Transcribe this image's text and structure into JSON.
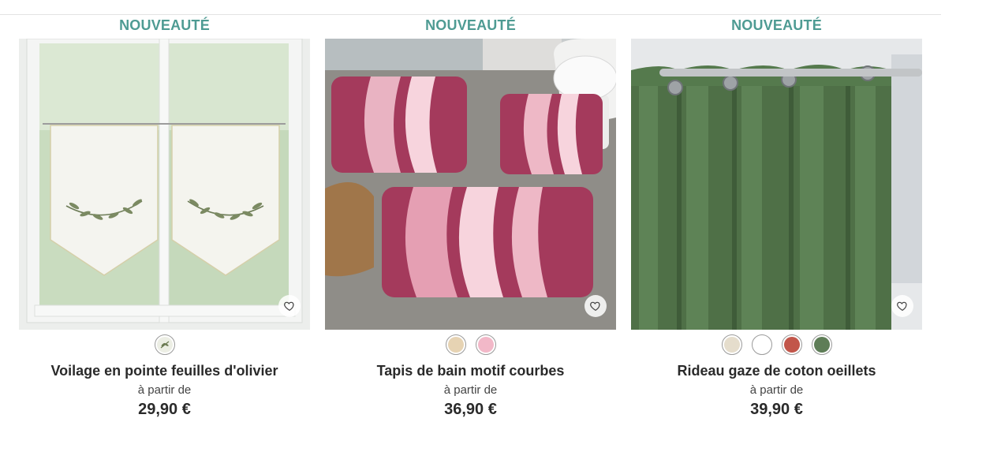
{
  "colors": {
    "badge": "#4e9b93",
    "text": "#2a2a2a"
  },
  "products": [
    {
      "badge": "NOUVEAUTÉ",
      "title": "Voilage en pointe feuilles d'olivier",
      "price_prefix": "à partir de",
      "price": "29,90 €",
      "favorite_icon": "heart-outline-icon",
      "swatches": [
        {
          "name": "olive-leaf-pattern",
          "color": "#e9ece1"
        }
      ]
    },
    {
      "badge": "NOUVEAUTÉ",
      "title": "Tapis de bain motif courbes",
      "price_prefix": "à partir de",
      "price": "36,90 €",
      "favorite_icon": "heart-outline-icon",
      "swatches": [
        {
          "name": "beige",
          "color": "#e6d3b3"
        },
        {
          "name": "pink",
          "color": "#f2b8c8"
        }
      ]
    },
    {
      "badge": "NOUVEAUTÉ",
      "title": "Rideau gaze de coton oeillets",
      "price_prefix": "à partir de",
      "price": "39,90 €",
      "favorite_icon": "heart-outline-icon",
      "swatches": [
        {
          "name": "linen",
          "color": "#e5ddcc"
        },
        {
          "name": "white",
          "color": "#ffffff"
        },
        {
          "name": "terracotta",
          "color": "#c2564a"
        },
        {
          "name": "green",
          "color": "#5e7d57"
        }
      ]
    }
  ]
}
